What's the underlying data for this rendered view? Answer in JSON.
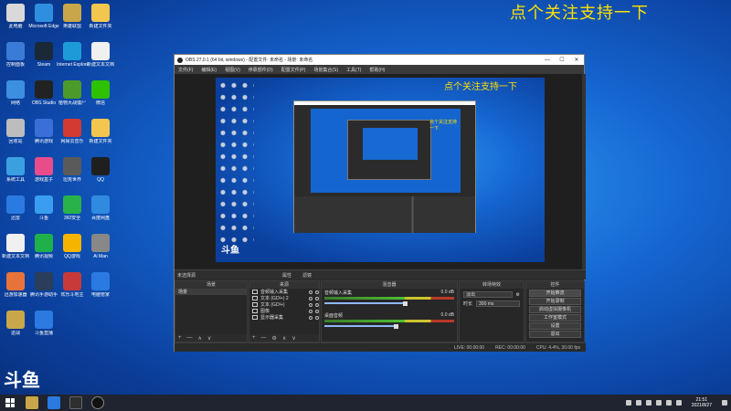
{
  "overlay": {
    "title": "点个关注支持一下"
  },
  "desktop": {
    "icons": [
      {
        "label": "此电脑",
        "color": "#d9d9d9"
      },
      {
        "label": "Microsoft Edge",
        "color": "#2e8fe0"
      },
      {
        "label": "英雄联盟",
        "color": "#c9a64a"
      },
      {
        "label": "新建文件夹",
        "color": "#f3c74e"
      },
      {
        "label": "控制面板",
        "color": "#3b7bd8"
      },
      {
        "label": "Steam",
        "color": "#1b2838"
      },
      {
        "label": "Internet Explorer",
        "color": "#1d9bd9"
      },
      {
        "label": "新建文本文档",
        "color": "#f0f0f0"
      },
      {
        "label": "网络",
        "color": "#3d8fe0"
      },
      {
        "label": "OBS Studio",
        "color": "#222222"
      },
      {
        "label": "植物大战僵尸",
        "color": "#4c9a2a"
      },
      {
        "label": "微信",
        "color": "#2dc100"
      },
      {
        "label": "回收站",
        "color": "#bdbdbd"
      },
      {
        "label": "腾讯游戏",
        "color": "#3a6fd8"
      },
      {
        "label": "网易云音乐",
        "color": "#d33a31"
      },
      {
        "label": "新建文件夹",
        "color": "#f3c74e"
      },
      {
        "label": "系统工具",
        "color": "#3aa0e0"
      },
      {
        "label": "游戏盒子",
        "color": "#e94c8a"
      },
      {
        "label": "坦克世界",
        "color": "#5a5a5a"
      },
      {
        "label": "QQ",
        "color": "#1f1f1f"
      },
      {
        "label": "迅雷",
        "color": "#2a7ae2"
      },
      {
        "label": "斗鱼",
        "color": "#3a9df0"
      },
      {
        "label": "360安全",
        "color": "#2ab24a"
      },
      {
        "label": "百度网盘",
        "color": "#2f8ae0"
      },
      {
        "label": "新建文本文档",
        "color": "#f0f0f0"
      },
      {
        "label": "腾讯视频",
        "color": "#20b04a"
      },
      {
        "label": "QQ游戏",
        "color": "#f4b400"
      },
      {
        "label": "Ai Man",
        "color": "#888888"
      },
      {
        "label": "迅游加速器",
        "color": "#e8733a"
      },
      {
        "label": "腾讯手游助手",
        "color": "#2a3d5a"
      },
      {
        "label": "欢乐斗地主",
        "color": "#c83a3a"
      },
      {
        "label": "电脑管家",
        "color": "#2a7ae2"
      },
      {
        "label": "逆战",
        "color": "#c9a64a"
      },
      {
        "label": "斗鱼直播",
        "color": "#2a7ae2"
      }
    ],
    "logo": "斗鱼"
  },
  "obs": {
    "window_title": "OBS 27.0.1 (64 bit, windows) - 配置文件: 未命名 - 场景: 未命名",
    "min_glyph": "—",
    "max_glyph": "☐",
    "close_glyph": "✕",
    "menu": [
      "文件(F)",
      "编辑(E)",
      "视图(V)",
      "停靠部件(D)",
      "配置文件(P)",
      "场景集合(S)",
      "工具(T)",
      "帮助(H)"
    ],
    "preview_title": "点个关注支持一下",
    "mini_title": "点个关注支持一下",
    "preview_logo": "斗鱼",
    "scene_label": "未选择源",
    "props_label": "属性",
    "filters_label": "滤镜",
    "docks": {
      "scenes": {
        "title": "场景",
        "items": [
          "场景"
        ]
      },
      "sources": {
        "title": "来源",
        "items": [
          "音频输入采集",
          "文本 (GDI+) 2",
          "文本 (GDI+)",
          "图像",
          "显示器采集"
        ]
      },
      "mixer": {
        "title": "混音器",
        "channels": [
          {
            "name": "音频输入采集",
            "db": "0.0 dB",
            "level": 0.62
          },
          {
            "name": "桌面音频",
            "db": "0.0 dB",
            "level": 0.55
          }
        ]
      },
      "transitions": {
        "title": "转场特效",
        "type": "淡出",
        "duration_label": "时长",
        "duration": "300 ms"
      },
      "controls": {
        "title": "控件",
        "buttons": [
          "开始推流",
          "开始录制",
          "启动虚拟摄像机",
          "工作室模式",
          "设置",
          "退出"
        ]
      }
    },
    "footer_symbols": [
      "+",
      "—",
      "⚙",
      "∧",
      "∨"
    ],
    "status": {
      "live": "LIVE: 00:00:00",
      "rec": "REC: 00:00:00",
      "cpu": "CPU: 4.4%, 30.00 fps"
    }
  },
  "taskbar": {
    "time": "21:51",
    "date": "2021/8/27"
  }
}
